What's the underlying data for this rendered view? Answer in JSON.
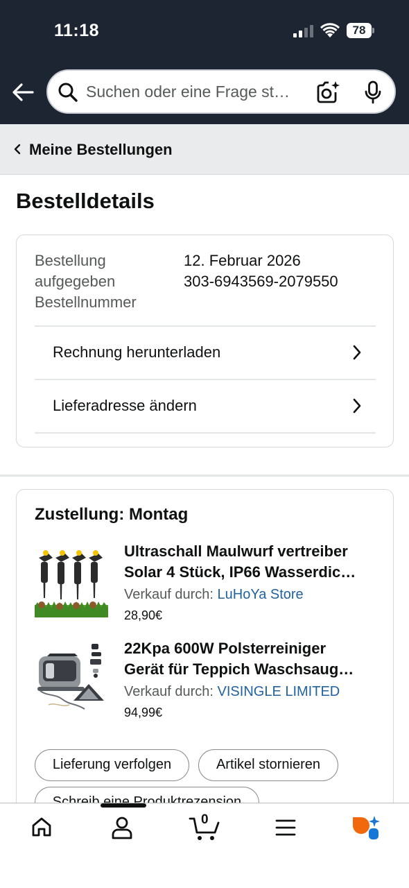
{
  "status_bar": {
    "time": "11:18",
    "battery": "78"
  },
  "search": {
    "placeholder": "Suchen oder eine Frage st…"
  },
  "breadcrumb": {
    "label": "Meine Bestellungen"
  },
  "page": {
    "title": "Bestelldetails"
  },
  "order": {
    "labels": [
      "Bestellung",
      "aufgegeben",
      "Bestellnummer"
    ],
    "date": "12. Februar 2026",
    "number": "303-6943569-2079550",
    "actions": [
      {
        "label": "Rechnung herunterladen"
      },
      {
        "label": "Lieferadresse ändern"
      }
    ]
  },
  "delivery": {
    "title": "Zustellung: Montag",
    "items": [
      {
        "title_line1": "Ultraschall Maulwurf vertreiber",
        "title_line2": "Solar 4 Stück, IP66 Wasserdic…",
        "seller_prefix": "Verkauf durch: ",
        "seller": "LuHoYa Store",
        "price": "28,90€"
      },
      {
        "title_line1": "22Kpa 600W Polsterreiniger",
        "title_line2": "Gerät für Teppich Waschsaug…",
        "seller_prefix": "Verkauf durch: ",
        "seller": "VISINGLE LIMITED",
        "price": "94,99€"
      }
    ],
    "buttons": {
      "track": "Lieferung verfolgen",
      "cancel": "Artikel stornieren",
      "review": "Schreib eine Produktrezension"
    }
  },
  "bottom_nav": {
    "icons": [
      "home-icon",
      "account-icon",
      "cart-icon",
      "menu-icon",
      "ai-assistant-icon"
    ],
    "cart_count": "0"
  },
  "colors": {
    "header_bg": "#1e2532",
    "link": "#2162a1",
    "breadcrumb_bg": "#e9ebec"
  }
}
